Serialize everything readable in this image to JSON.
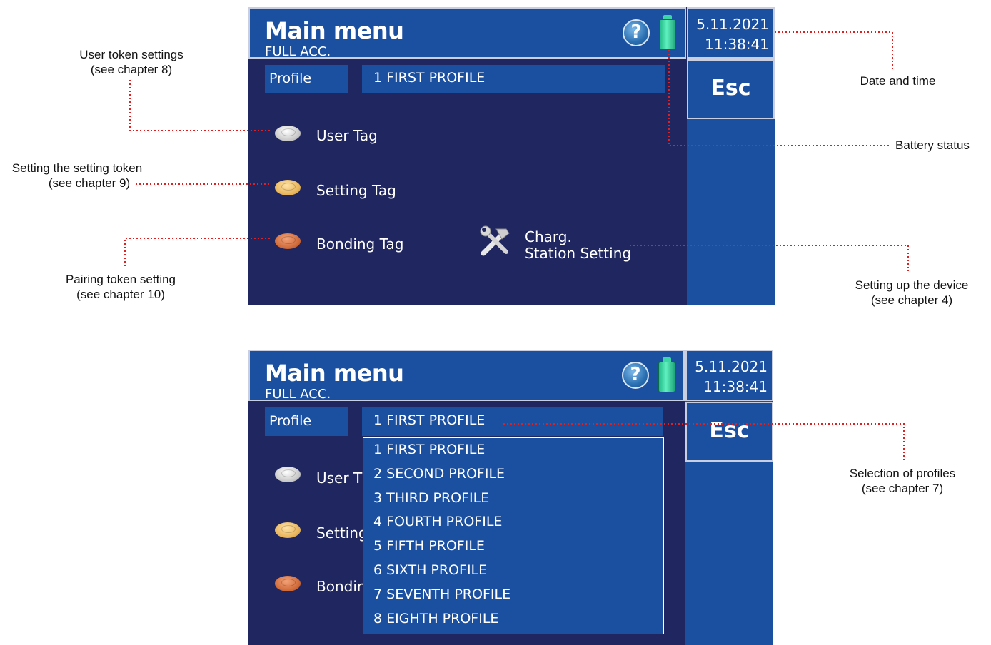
{
  "screen": {
    "title": "Main menu",
    "subtitle": "FULL ACC.",
    "help_icon_glyph": "?",
    "battery_icon": "battery-full-icon",
    "date": "5.11.2021",
    "time": "11:38:41",
    "esc_label": "Esc",
    "profile_label": "Profile",
    "profile_selected": "1 FIRST PROFILE",
    "tags": [
      {
        "label": "User Tag",
        "icon": "silver-token-icon"
      },
      {
        "label": "Setting Tag",
        "icon": "gold-token-icon"
      },
      {
        "label": "Bonding Tag",
        "icon": "copper-token-icon"
      }
    ],
    "truncated_tags": [
      "User T",
      "Setting",
      "Bondir"
    ],
    "charg_line1": "Charg.",
    "charg_line2": "Station Setting",
    "tools_icon": "hammer-wrench-icon"
  },
  "profile_options": [
    "1 FIRST PROFILE",
    "2 SECOND PROFILE",
    "3 THIRD PROFILE",
    "4 FOURTH PROFILE",
    "5 FIFTH PROFILE",
    "6 SIXTH PROFILE",
    "7 SEVENTH PROFILE",
    "8 EIGHTH PROFILE"
  ],
  "callouts": {
    "user_token": [
      "User token settings",
      "(see chapter 8)"
    ],
    "setting_token": [
      "Setting the setting token",
      "(see chapter 9)"
    ],
    "pairing_token": [
      "Pairing token setting",
      "(see chapter 10)"
    ],
    "date_time": [
      "Date and time"
    ],
    "battery": [
      "Battery status"
    ],
    "device_setup": [
      "Setting up the device",
      "(see chapter 4)"
    ],
    "profiles": [
      "Selection of profiles",
      "(see chapter 7)"
    ]
  },
  "colors": {
    "screen_bg": "#1f2660",
    "panel_blue": "#1b4fa0",
    "leader_red": "#e02020"
  }
}
